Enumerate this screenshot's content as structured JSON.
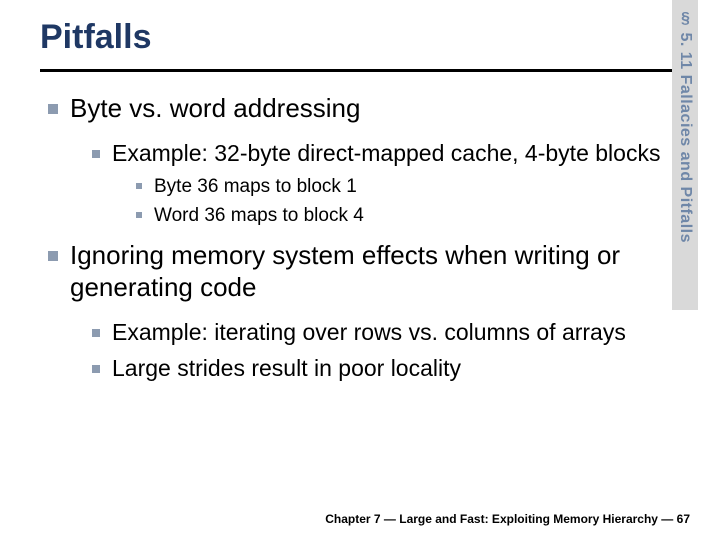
{
  "title": "Pitfalls",
  "section_label": "§ 5. 11 Fallacies and Pitfalls",
  "bullets": {
    "b1": "Byte vs. word addressing",
    "b1_1": "Example: 32-byte direct-mapped cache, 4-byte blocks",
    "b1_1_1": "Byte 36 maps to block 1",
    "b1_1_2": "Word 36 maps to block 4",
    "b2": "Ignoring memory system effects when writing or generating code",
    "b2_1": "Example: iterating over rows vs. columns of arrays",
    "b2_2": "Large strides result in poor locality"
  },
  "footer": "Chapter 7 — Large and Fast: Exploiting Memory Hierarchy — 67"
}
